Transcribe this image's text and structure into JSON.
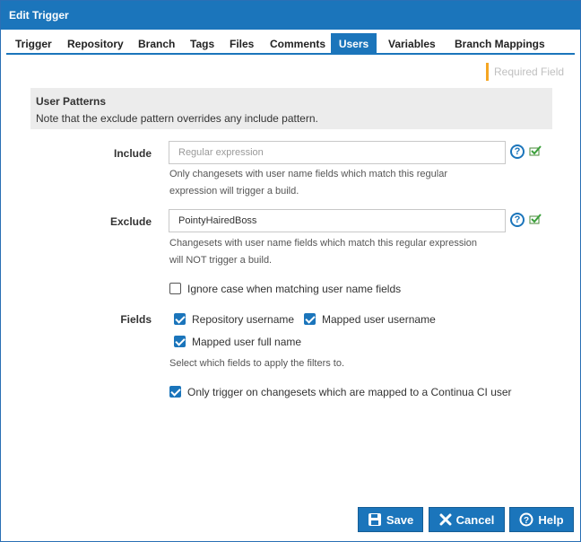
{
  "window": {
    "title": "Edit Trigger"
  },
  "tabs": [
    {
      "label": "Trigger",
      "active": false
    },
    {
      "label": "Repository",
      "active": false
    },
    {
      "label": "Branch",
      "active": false
    },
    {
      "label": "Tags",
      "active": false
    },
    {
      "label": "Files",
      "active": false
    },
    {
      "label": "Comments",
      "active": false
    },
    {
      "label": "Users",
      "active": true
    },
    {
      "label": "Variables",
      "active": false
    },
    {
      "label": "Branch Mappings",
      "active": false
    }
  ],
  "required_field_label": "Required Field",
  "section": {
    "title": "User Patterns",
    "note": "Note that the exclude pattern overrides any include pattern."
  },
  "include": {
    "label": "Include",
    "value": "",
    "placeholder": "Regular expression",
    "help_line1": "Only changesets with user name fields which match this regular",
    "help_line2": "expression will trigger a build."
  },
  "exclude": {
    "label": "Exclude",
    "value": "PointyHairedBoss",
    "placeholder": "",
    "help_line1": "Changesets with user name fields which match this regular expression",
    "help_line2": "will NOT trigger a build."
  },
  "ignore_case": {
    "label": "Ignore case when matching user name fields",
    "checked": false
  },
  "fields": {
    "label": "Fields",
    "options": [
      {
        "label": "Repository username",
        "checked": true
      },
      {
        "label": "Mapped user username",
        "checked": true
      },
      {
        "label": "Mapped user full name",
        "checked": true
      }
    ],
    "help": "Select which fields to apply the filters to."
  },
  "only_mapped": {
    "label": "Only trigger on changesets which are mapped to a Continua CI user",
    "checked": true
  },
  "buttons": {
    "save": "Save",
    "cancel": "Cancel",
    "help": "Help"
  },
  "icons": {
    "help": "question-circle-icon",
    "validate": "check-validate-icon",
    "save": "floppy-disk-icon",
    "cancel": "x-icon",
    "help_button": "question-circle-icon"
  },
  "colors": {
    "accent": "#1b75bb",
    "required": "#f5a623",
    "panel": "#ececec"
  }
}
